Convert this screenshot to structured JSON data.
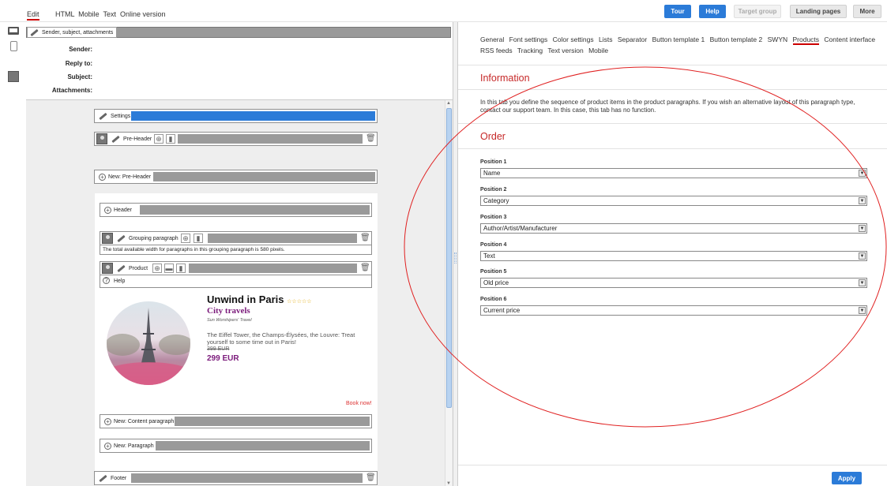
{
  "topbar": {
    "edit_tab": "Edit",
    "view_tabs": "HTML  Mobile  Text  Online version",
    "buttons": {
      "tour": "Tour",
      "help": "Help",
      "target_group": "Target group",
      "landing_pages": "Landing pages",
      "more": "More"
    }
  },
  "header_panel": {
    "section_tab": "Sender, subject, attachments",
    "fields": {
      "sender": "Sender:",
      "reply_to": "Reply to:",
      "subject": "Subject:",
      "attachments": "Attachments:"
    }
  },
  "editor": {
    "settings": "Settings",
    "pre_header": "Pre-Header",
    "new_pre_header": "New: Pre-Header",
    "header": "Header",
    "grouping_paragraph": "Grouping paragraph",
    "grouping_note": "The total available width for paragraphs in this grouping paragraph is 580 pixels.",
    "product": "Product",
    "help": "Help",
    "new_content_paragraph": "New: Content paragraph",
    "new_paragraph": "New: Paragraph",
    "footer": "Footer"
  },
  "product_card": {
    "title": "Unwind in Paris",
    "stars": "☆☆☆☆☆",
    "subtitle": "City travels",
    "brand": "Sun Worshipers' Travel",
    "description": "The Eiffel Tower, the Champs-Élysées, the Louvre: Treat yourself to some time out in Paris!",
    "old_price": "399 EUR",
    "price": "299 EUR",
    "cta": "Book now!"
  },
  "right_panel": {
    "tabs": [
      "General",
      "Font settings",
      "Color settings",
      "Lists",
      "Separator",
      "Button template 1",
      "Button template 2",
      "SWYN",
      "Products",
      "Content interface",
      "RSS feeds",
      "Tracking",
      "Text version",
      "Mobile"
    ],
    "active_tab": "Products",
    "information_heading": "Information",
    "information_text": "In this tab you define the sequence of product items in the product paragraphs. If you wish an alternative layout of this paragraph type, contact our support team. In this case, this tab has no function.",
    "order_heading": "Order",
    "positions": [
      {
        "label": "Position 1",
        "value": "Name"
      },
      {
        "label": "Position 2",
        "value": "Category"
      },
      {
        "label": "Position 3",
        "value": "Author/Artist/Manufacturer"
      },
      {
        "label": "Position 4",
        "value": "Text"
      },
      {
        "label": "Position 5",
        "value": "Old price"
      },
      {
        "label": "Position 6",
        "value": "Current price"
      }
    ],
    "apply": "Apply"
  },
  "colors": {
    "accent_red": "#c62828",
    "button_blue": "#2b7bd8",
    "product_purple": "#7b1a7b",
    "annotation_ellipse": "#e02020"
  }
}
